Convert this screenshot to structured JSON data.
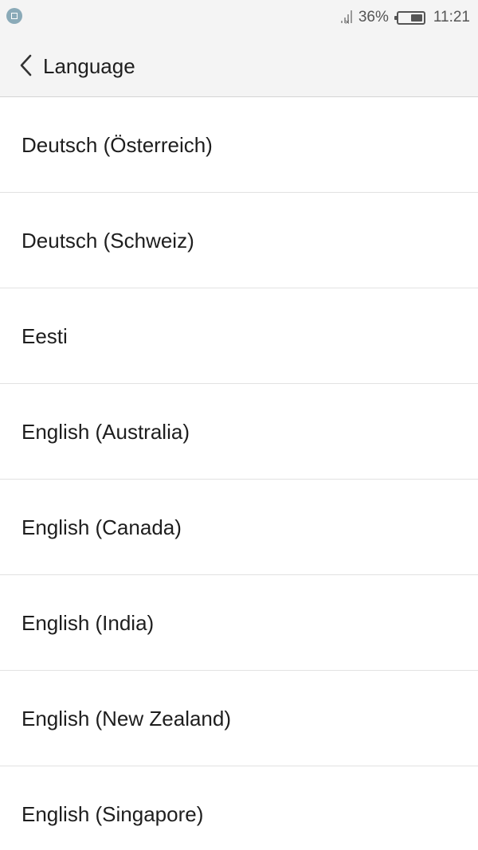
{
  "status_bar": {
    "battery_percent": "36%",
    "battery_level": 0.36,
    "time": "11:21"
  },
  "app_bar": {
    "title": "Language"
  },
  "languages": [
    {
      "label": "Deutsch (Österreich)"
    },
    {
      "label": "Deutsch (Schweiz)"
    },
    {
      "label": "Eesti"
    },
    {
      "label": "English (Australia)"
    },
    {
      "label": "English (Canada)"
    },
    {
      "label": "English (India)"
    },
    {
      "label": "English (New Zealand)"
    },
    {
      "label": "English (Singapore)"
    }
  ],
  "icons": {
    "notification": "app-notification-icon",
    "signal": "signal-no-sim-icon",
    "battery": "battery-icon",
    "back": "chevron-left-icon"
  }
}
